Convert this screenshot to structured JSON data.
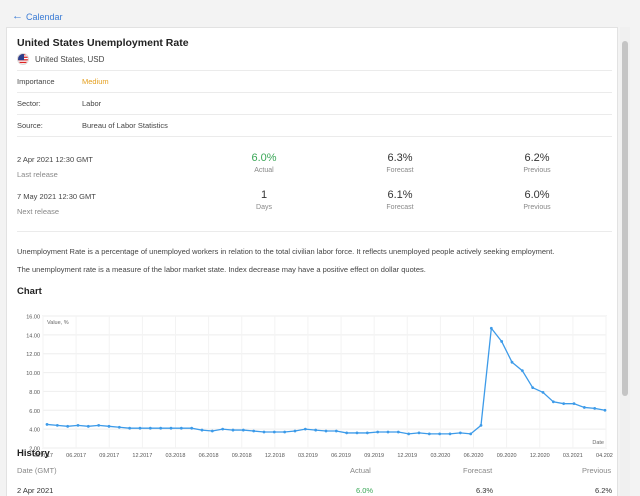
{
  "nav": {
    "back_label": "Calendar"
  },
  "event": {
    "title": "United States Unemployment Rate",
    "country": "United States, USD",
    "importance_key": "Importance",
    "importance_value": "Medium",
    "sector_key": "Sector:",
    "sector_value": "Labor",
    "source_key": "Source:",
    "source_value": "Bureau of Labor Statistics"
  },
  "last_release": {
    "date": "2 Apr 2021 12:30 GMT",
    "label": "Last release",
    "actual": "6.0%",
    "actual_label": "Actual",
    "forecast": "6.3%",
    "forecast_label": "Forecast",
    "previous": "6.2%",
    "previous_label": "Previous"
  },
  "next_release": {
    "date": "7 May 2021 12:30 GMT",
    "label": "Next release",
    "days": "1",
    "days_label": "Days",
    "forecast": "6.1%",
    "forecast_label": "Forecast",
    "previous": "6.0%",
    "previous_label": "Previous"
  },
  "description": {
    "p1": "Unemployment Rate is a percentage of unemployed workers in relation to the total civilian labor force. It reflects unemployed people actively seeking employment.",
    "p2": "The unemployment rate is a measure of the labor market state. Index decrease may have a positive effect on dollar quotes."
  },
  "chart_section_title": "Chart",
  "chart_data": {
    "type": "line",
    "ylabel": "Value, %",
    "xlabel": "Date",
    "ylim": [
      2,
      16
    ],
    "y_ticks": [
      "2.00",
      "4.00",
      "6.00",
      "8.00",
      "10.00",
      "12.00",
      "14.00",
      "16.00"
    ],
    "x_ticks": [
      "03.2017",
      "06.2017",
      "09.2017",
      "12.2017",
      "03.2018",
      "06.2018",
      "09.2018",
      "12.2018",
      "03.2019",
      "06.2019",
      "09.2019",
      "12.2019",
      "03.2020",
      "06.2020",
      "09.2020",
      "12.2020",
      "03.2021",
      "04.2021"
    ],
    "grid": true,
    "color": "#3d9be9",
    "series": [
      {
        "values": [
          4.5,
          4.4,
          4.3,
          4.4,
          4.3,
          4.4,
          4.3,
          4.2,
          4.1,
          4.1,
          4.1,
          4.1,
          4.1,
          4.1,
          4.1,
          3.9,
          3.8,
          4.0,
          3.9,
          3.9,
          3.8,
          3.7,
          3.7,
          3.7,
          3.8,
          4.0,
          3.9,
          3.8,
          3.8,
          3.6,
          3.6,
          3.6,
          3.7,
          3.7,
          3.7,
          3.5,
          3.6,
          3.5,
          3.5,
          3.5,
          3.6,
          3.5,
          4.4,
          14.7,
          13.3,
          11.1,
          10.2,
          8.4,
          7.9,
          6.9,
          6.7,
          6.7,
          6.3,
          6.2,
          6.0
        ]
      }
    ]
  },
  "history_section_title": "History",
  "history": {
    "headers": {
      "date": "Date (GMT)",
      "actual": "Actual",
      "forecast": "Forecast",
      "previous": "Previous"
    },
    "rows": [
      {
        "date": "2 Apr 2021",
        "actual": "6.0%",
        "forecast": "6.3%",
        "previous": "6.2%"
      }
    ]
  },
  "colors": {
    "accent": "#3a7bd5",
    "positive": "#3aa757",
    "medium": "#e5a020",
    "line": "#3d9be9"
  }
}
